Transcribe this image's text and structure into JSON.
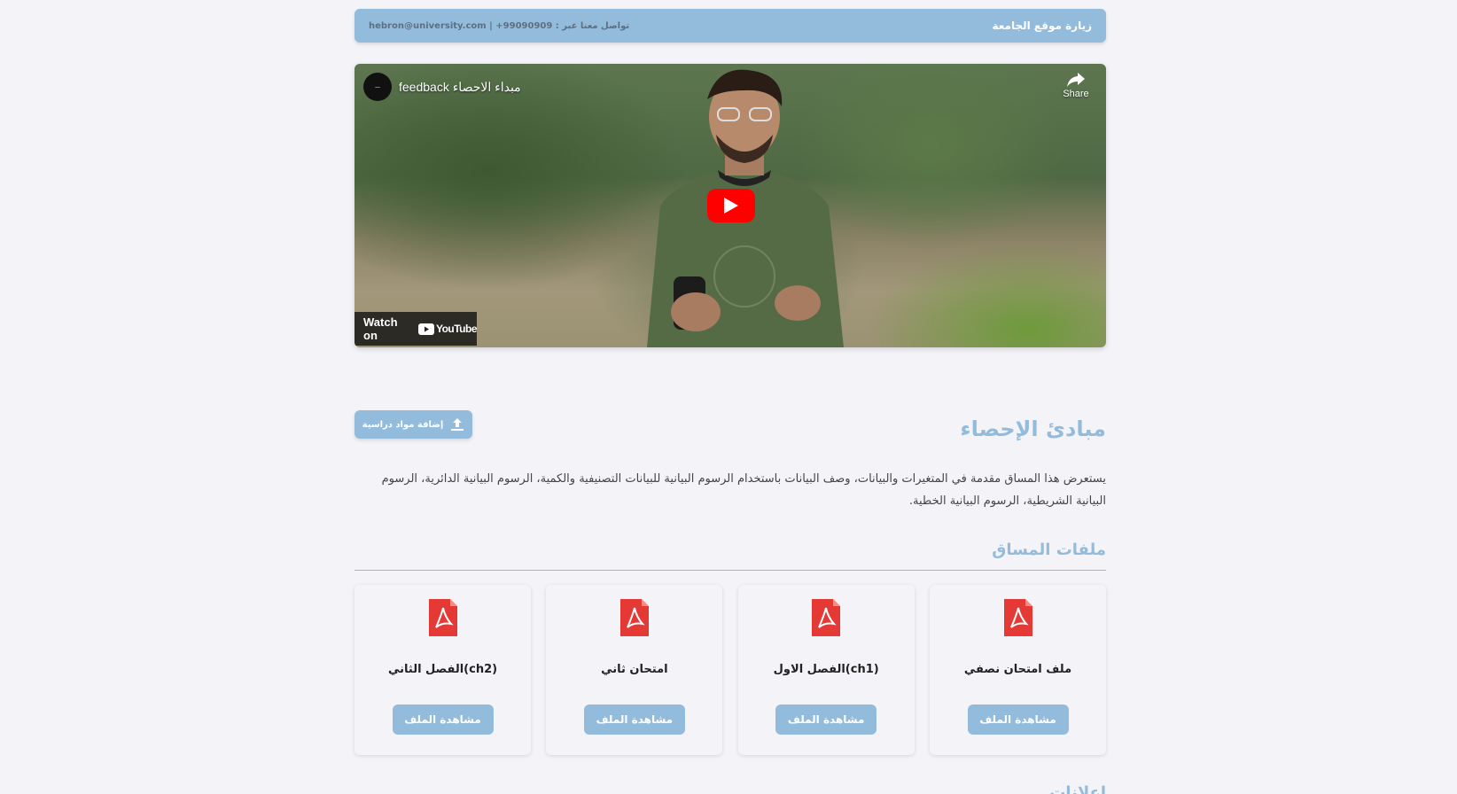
{
  "topbar": {
    "visit_link": "زيارة موقع الجامعة",
    "contact": "تواصل معنا عبر : hebron@university.com | +99090909"
  },
  "video": {
    "channel_avatar_text": "—",
    "title": "feedback مبداء الاحصاء",
    "share_label": "Share",
    "watch_on_label": "Watch on",
    "youtube_label": "YouTube"
  },
  "course": {
    "title": "مبادئ الإحصاء",
    "upload_button": "إضافة مواد دراسية",
    "description": "يستعرض هذا المساق مقدمة في المتغيرات والبيانات، وصف البيانات باستخدام الرسوم البيانية للبيانات التصنيفية والكمية، الرسوم البيانية الدائرية، الرسوم البيانية الشريطية، الرسوم البيانية الخطية."
  },
  "files": {
    "heading": "ملفات المساق",
    "items": [
      {
        "name": "ملف امتحان نصفي",
        "button": "مشاهدة الملف"
      },
      {
        "name": "(ch1)الفصل الاول",
        "button": "مشاهدة الملف"
      },
      {
        "name": "امتحان ثاني",
        "button": "مشاهدة الملف"
      },
      {
        "name": "(ch2)الفصل الثاني",
        "button": "مشاهدة الملف"
      }
    ]
  },
  "next_section": {
    "heading": "إعلانات"
  },
  "colors": {
    "accent": "#93bcdc",
    "pdf_red": "#e53935",
    "youtube_red": "#ff0000"
  }
}
